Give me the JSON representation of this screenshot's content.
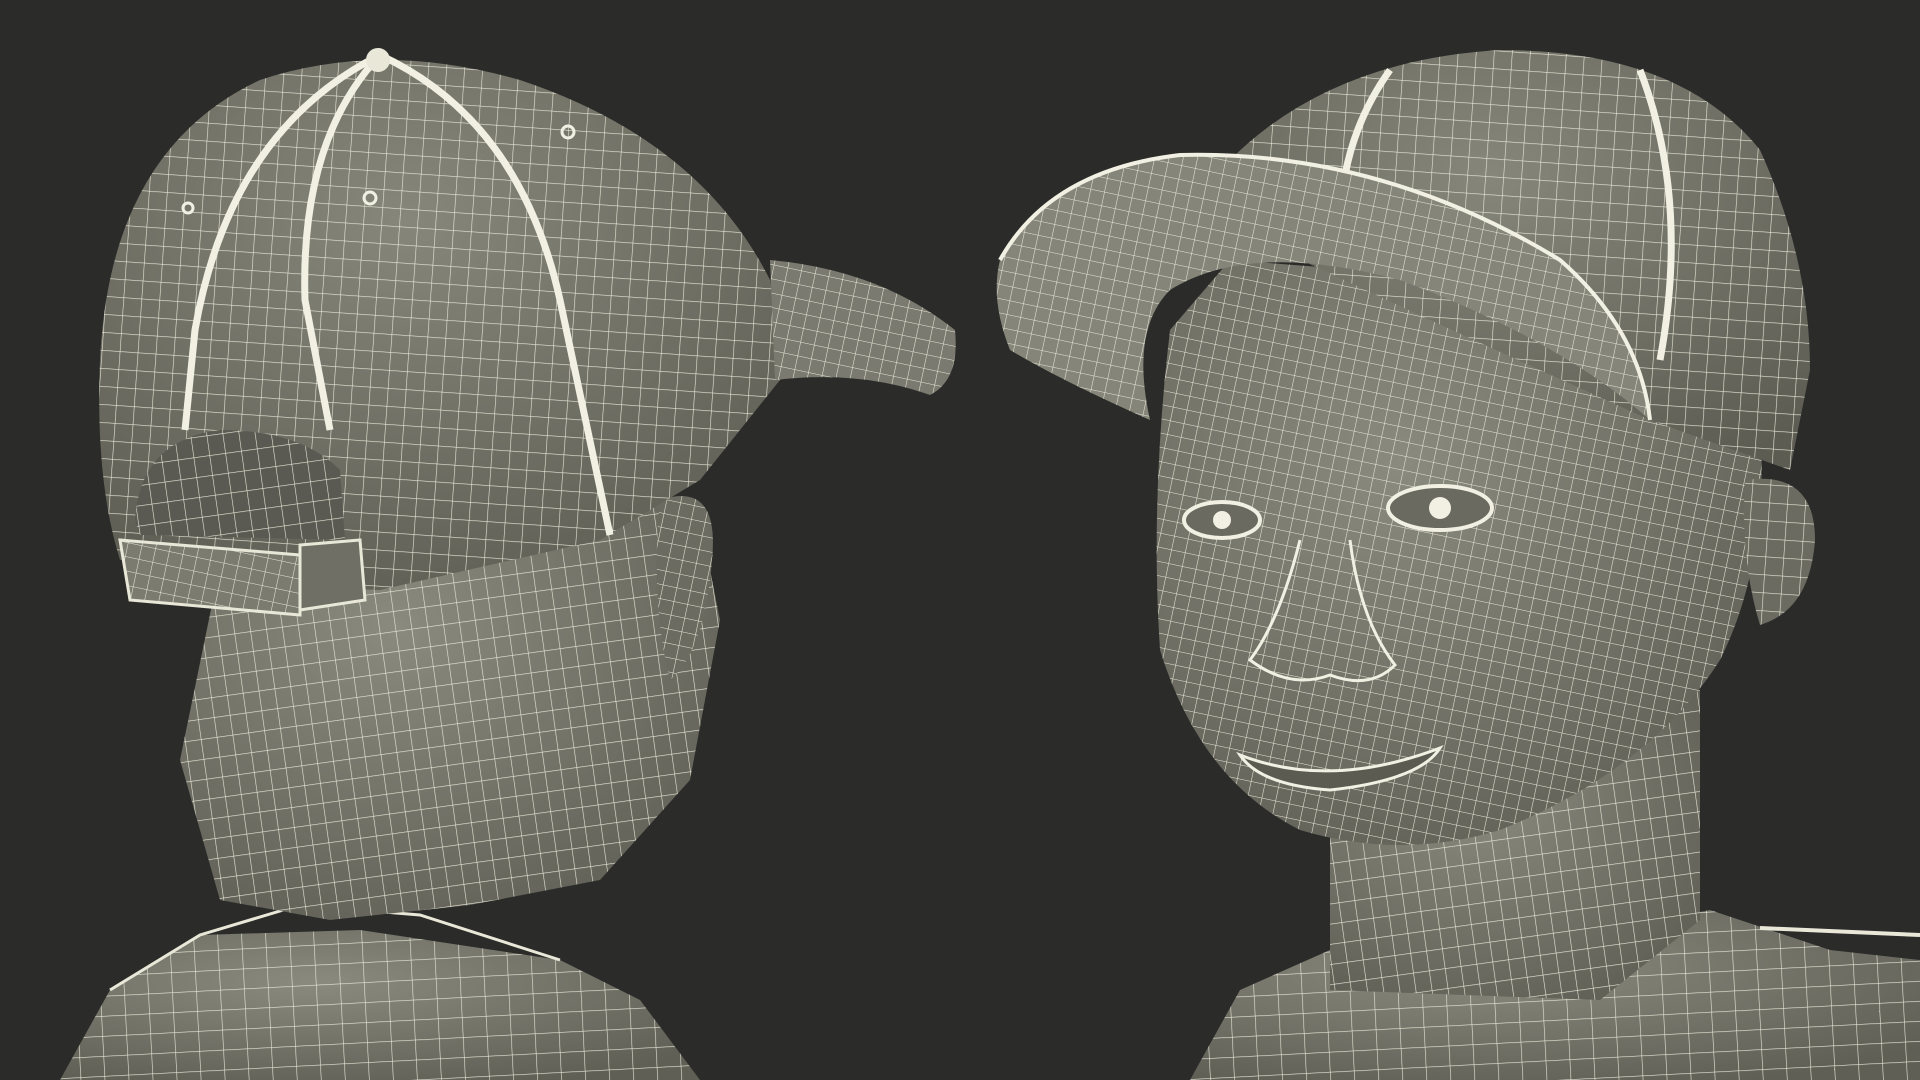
{
  "scene": {
    "background_color": "#2b2b29",
    "mesh_fill_color": "#7d7d72",
    "mesh_shadow_color": "#5e5e55",
    "wire_color": "#e9e8d8",
    "views": [
      {
        "name": "back-view",
        "subject": "head-with-baseball-cap"
      },
      {
        "name": "front-view",
        "subject": "head-with-baseball-cap"
      }
    ]
  }
}
